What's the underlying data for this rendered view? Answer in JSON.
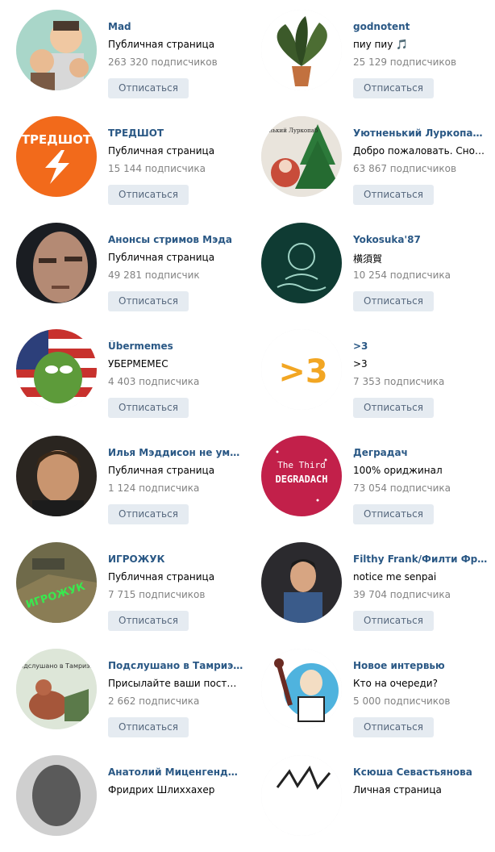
{
  "unsubscribe_label": "Отписаться",
  "communities": [
    {
      "name": "Mad",
      "description": "Публичная страница",
      "followers": "263 320 подписчиков",
      "avatar_icon": "cartoon-group-icon"
    },
    {
      "name": "godnotent",
      "description": "пиу пиу 🎵",
      "followers": "25 129 подписчиков",
      "avatar_icon": "potted-plant-icon"
    },
    {
      "name": "ТРЕДШОТ",
      "description": "Публичная страница",
      "followers": "15 144 подписчика",
      "avatar_icon": "lightning-logo-icon",
      "avatar_text": "ТРЕДШОТ"
    },
    {
      "name": "Уютненький Луркопаб | Lurkopub",
      "description": "Добро пожаловать. Снова.",
      "followers": "63 867 подписчиков",
      "avatar_icon": "christmas-tree-icon",
      "avatar_text": "Уютненький Луркопаб"
    },
    {
      "name": "Анонсы стримов Мэда",
      "description": "Публичная страница",
      "followers": "49 281 подписчик",
      "avatar_icon": "man-face-icon"
    },
    {
      "name": "Yokosuka'87",
      "description": "横須賀",
      "followers": "10 254 подписчика",
      "avatar_icon": "geisha-logo-icon"
    },
    {
      "name": "Übermemes",
      "description": "УБЕРМЕМЕС",
      "followers": "4 403 подписчика",
      "avatar_icon": "pepe-frog-icon"
    },
    {
      "name": ">3",
      "description": ">3",
      "followers": "7 353 подписчика",
      "avatar_icon": "greater-three-logo-icon",
      "avatar_text": ">3"
    },
    {
      "name": "Илья Мэддисон не умер?",
      "description": "Публичная страница",
      "followers": "1 124 подписчика",
      "avatar_icon": "young-man-photo-icon"
    },
    {
      "name": "Деградач",
      "description": "100% ориджинал",
      "followers": "73 054 подписчика",
      "avatar_icon": "galaxy-logo-icon",
      "avatar_text_top": "The Third",
      "avatar_text_bottom": "DEGRADACH"
    },
    {
      "name": "ИГРОЖУК",
      "description": "Публичная страница",
      "followers": "7 715 подписчиков",
      "avatar_icon": "game-scene-icon",
      "avatar_text": "ИГРОЖУК"
    },
    {
      "name": "Filthy Frank/Филти Фрэнк",
      "description": "notice me senpai",
      "followers": "39 704 подписчика",
      "avatar_icon": "man-portrait-icon"
    },
    {
      "name": "Подслушано в Тамриэле - TES",
      "description": "Присылайте ваши посты через предложку",
      "followers": "2 662 подписчика",
      "avatar_icon": "chicken-drawing-icon",
      "avatar_text": "Подслушано в Тамриэле"
    },
    {
      "name": "Новое интервью",
      "description": "Кто на очереди?",
      "followers": "5 000 подписчиков",
      "avatar_icon": "microphone-man-icon"
    },
    {
      "name": "Анатолий Миценгендлер",
      "description": "Фридрих Шлиххахер",
      "followers": "",
      "avatar_icon": "portrait-sketch-icon"
    },
    {
      "name": "Ксюша Севастьянова",
      "description": "Личная страница",
      "followers": "",
      "avatar_icon": "sketch-drawing-icon"
    }
  ]
}
